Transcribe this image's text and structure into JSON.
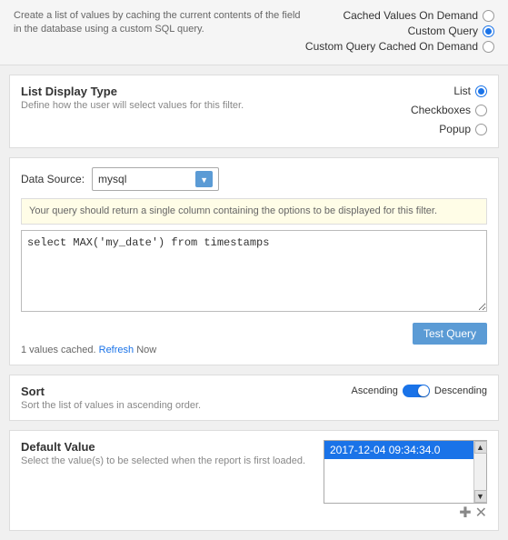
{
  "top": {
    "description": "Create a list of values by caching the current contents of the field in the database using a custom SQL query.",
    "radio_options": [
      {
        "label": "Cached Values On Demand",
        "selected": false
      },
      {
        "label": "Custom Query",
        "selected": true
      },
      {
        "label": "Custom Query Cached On Demand",
        "selected": false
      }
    ]
  },
  "list_display": {
    "title": "List Display Type",
    "description": "Define how the user will select values for this filter.",
    "options": [
      {
        "label": "List",
        "selected": true
      },
      {
        "label": "Checkboxes",
        "selected": false
      },
      {
        "label": "Popup",
        "selected": false
      }
    ]
  },
  "query": {
    "datasource_label": "Data Source:",
    "datasource_value": "mysql",
    "hint": "Your query should return a single column containing the options to be displayed for this filter.",
    "query_text": "select MAX('my_date') from timestamps",
    "test_button": "Test Query",
    "cache_status": "1 values cached.",
    "refresh_link": "Refresh",
    "refresh_now": "Now"
  },
  "sort": {
    "title": "Sort",
    "description": "Sort the list of values in ascending order.",
    "ascending_label": "Ascending",
    "descending_label": "Descending"
  },
  "default_value": {
    "title": "Default Value",
    "description": "Select the value(s) to be selected when the report is first loaded.",
    "selected_item": "2017-12-04 09:34:34.0",
    "add_icon": "✚",
    "remove_icon": "✕"
  }
}
